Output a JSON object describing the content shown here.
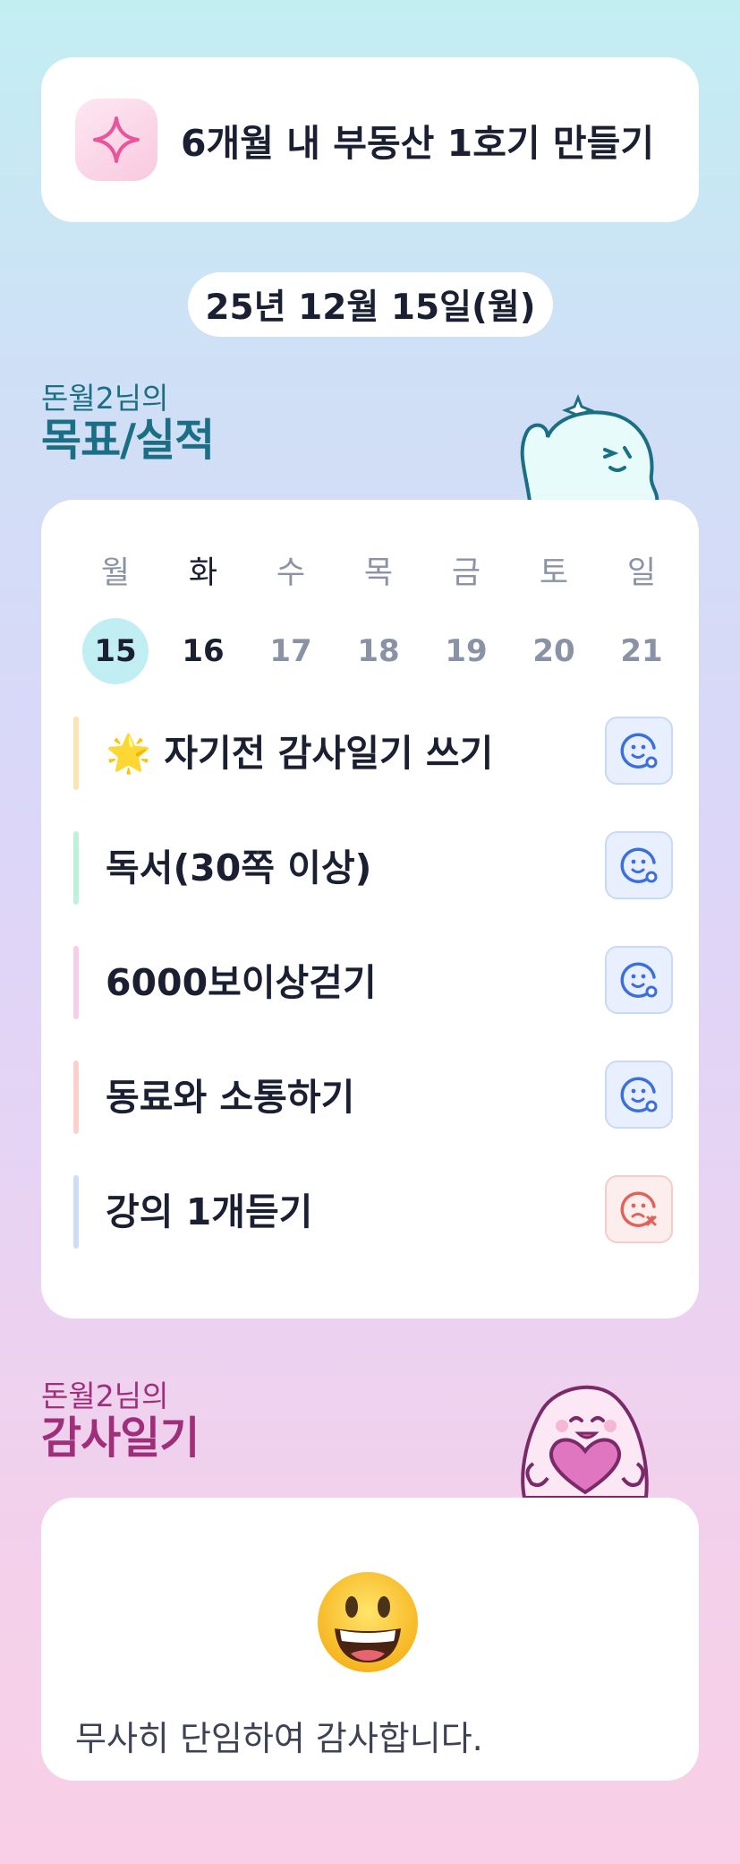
{
  "goal": {
    "icon": "sparkle-icon",
    "text": "6개월 내 부동산 1호기 만들기"
  },
  "date": "25년 12월 15일(월)",
  "tracker_section": {
    "subtitle": "돈월2님의",
    "title": "목표/실적"
  },
  "week": [
    {
      "name": "월",
      "num": "15",
      "selected": true,
      "today": false
    },
    {
      "name": "화",
      "num": "16",
      "selected": false,
      "today": true
    },
    {
      "name": "수",
      "num": "17",
      "selected": false,
      "today": false
    },
    {
      "name": "목",
      "num": "18",
      "selected": false,
      "today": false
    },
    {
      "name": "금",
      "num": "19",
      "selected": false,
      "today": false
    },
    {
      "name": "토",
      "num": "20",
      "selected": false,
      "today": false
    },
    {
      "name": "일",
      "num": "21",
      "selected": false,
      "today": false
    }
  ],
  "tasks": [
    {
      "label": "🌟 자기전 감사일기 쓰기",
      "bar_color": "#fde3b5",
      "status": "done",
      "status_icon": "smile-check-icon"
    },
    {
      "label": "독서(30쪽 이상)",
      "bar_color": "#bff0dc",
      "status": "done",
      "status_icon": "smile-check-icon"
    },
    {
      "label": "6000보이상걷기",
      "bar_color": "#f8cde6",
      "status": "done",
      "status_icon": "smile-check-icon"
    },
    {
      "label": "동료와 소통하기",
      "bar_color": "#fcd0cb",
      "status": "done",
      "status_icon": "smile-check-icon"
    },
    {
      "label": "강의 1개듣기",
      "bar_color": "#cfdcf8",
      "status": "missed",
      "status_icon": "sad-x-icon"
    }
  ],
  "diary_section": {
    "subtitle": "돈월2님의",
    "title": "감사일기"
  },
  "diary": {
    "emoji": "grinning-face-icon",
    "text": "무사히 단임하여 감사합니다."
  },
  "colors": {
    "ok": "#3b6fe0",
    "bad": "#e0625a",
    "accent_teal": "#1b6f84",
    "accent_pink": "#a02f7b"
  }
}
